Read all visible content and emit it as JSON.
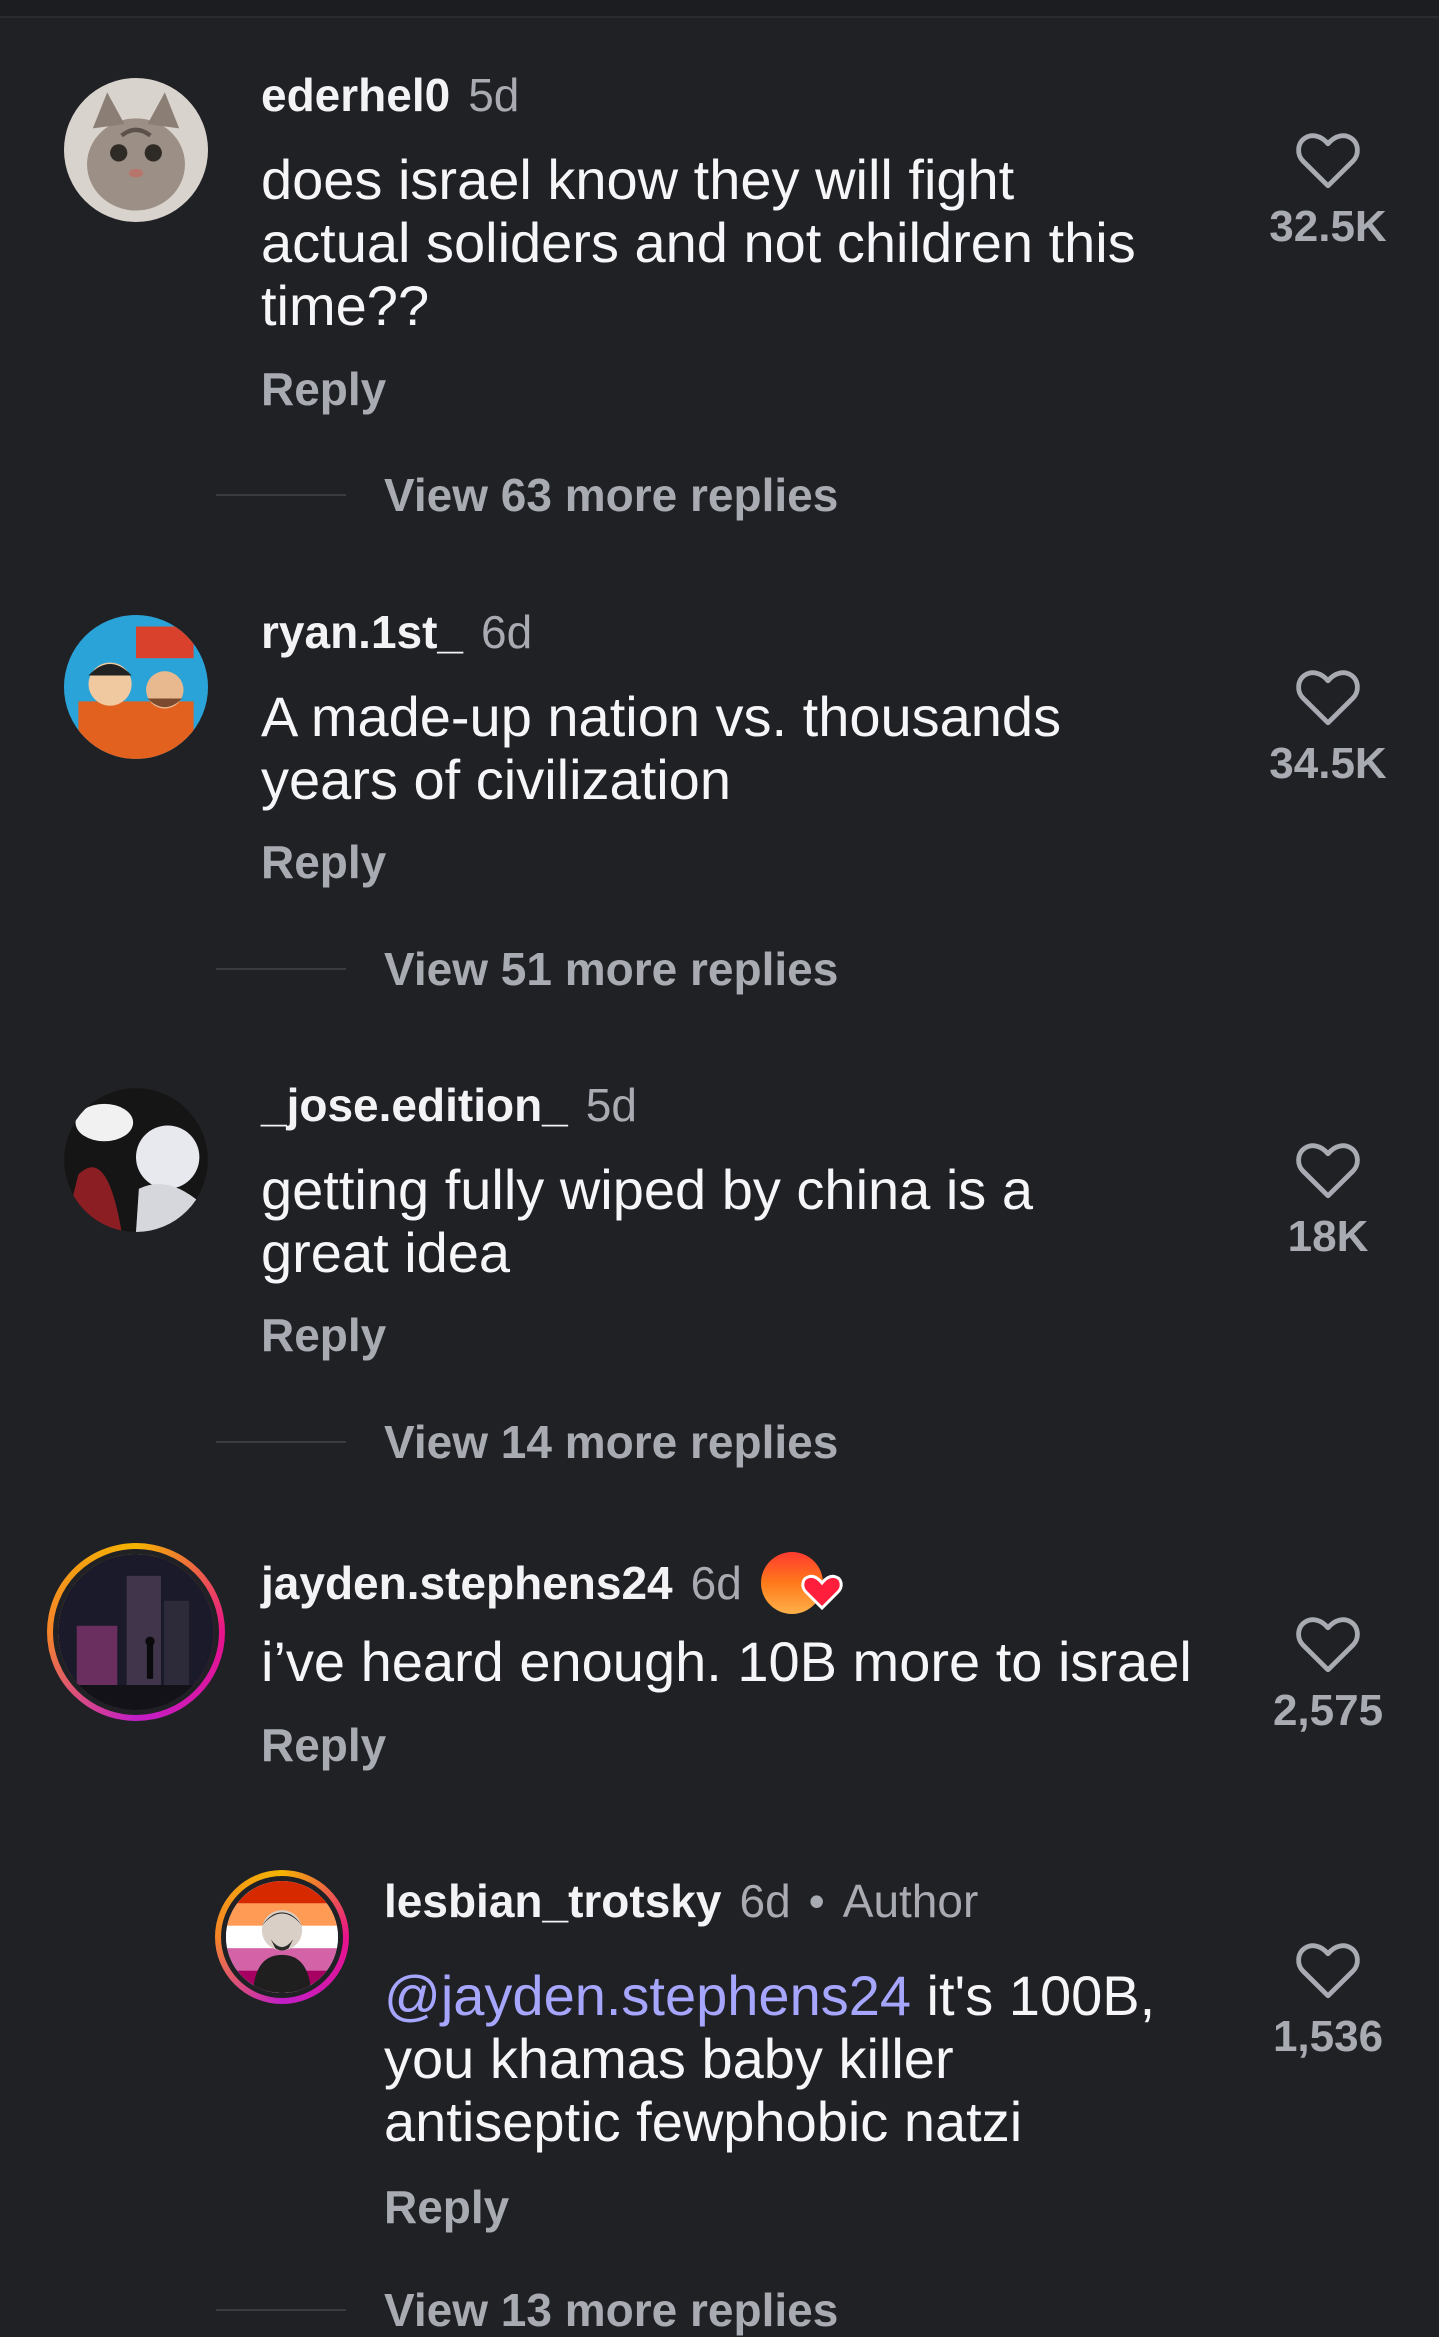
{
  "comments": [
    {
      "username": "ederhel0",
      "time": "5d",
      "lines": [
        "does israel know they will fight",
        "actual soliders and not children this",
        "time??"
      ],
      "likes": "32.5K",
      "reply": "Reply",
      "view_more": "View 63 more replies"
    },
    {
      "username": "ryan.1st_",
      "time": "6d",
      "lines": [
        "A made-up nation vs. thousands",
        "years of civilization"
      ],
      "likes": "34.5K",
      "reply": "Reply",
      "view_more": "View 51 more replies"
    },
    {
      "username": "_jose.edition_",
      "time": "5d",
      "lines": [
        "getting fully wiped by china is a",
        "great idea"
      ],
      "likes": "18K",
      "reply": "Reply",
      "view_more": "View 14 more replies"
    },
    {
      "username": "jayden.stephens24",
      "time": "6d",
      "lines": [
        "i’ve heard enough. 10B more to israel"
      ],
      "likes": "2,575",
      "reply": "Reply"
    },
    {
      "username": "lesbian_trotsky",
      "time": "6d",
      "dot": "•",
      "author": "Author",
      "mention": "@jayden.stephens24",
      "lines": [
        " it's 100B,",
        "you khamas baby killer",
        "antiseptic fewphobic natzi"
      ],
      "likes": "1,536",
      "reply": "Reply",
      "view_more": "View 13 more replies"
    }
  ],
  "icons": {
    "like": "heart-outline-icon",
    "badge": "heart-badge-icon"
  },
  "colors": {
    "background": "#202125",
    "mention": "#a7a6ff",
    "muted": "#a9abb2"
  }
}
